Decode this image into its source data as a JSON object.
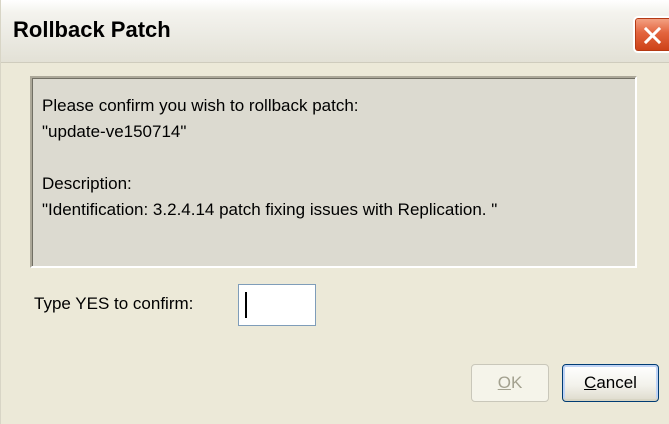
{
  "window": {
    "title": "Rollback Patch"
  },
  "titlebar": {
    "close_icon": "close-icon"
  },
  "message": {
    "line1": "Please confirm you wish to rollback patch:",
    "line2": "\"update-ve150714\"",
    "line3": "Description:",
    "line4": "\"Identification: 3.2.4.14 patch fixing issues with Replication. \""
  },
  "confirm": {
    "label": "Type YES to confirm:",
    "value": "",
    "placeholder": ""
  },
  "buttons": {
    "ok_mnemonic": "O",
    "ok_rest": "K",
    "ok_enabled": false,
    "cancel_mnemonic": "C",
    "cancel_rest": "ancel"
  },
  "colors": {
    "dialog_bg": "#ece9d8",
    "panel_bg": "#dcdad0",
    "close_button": "#e3643e",
    "disabled_text": "#a3a18f",
    "focus_border": "#003c74"
  }
}
